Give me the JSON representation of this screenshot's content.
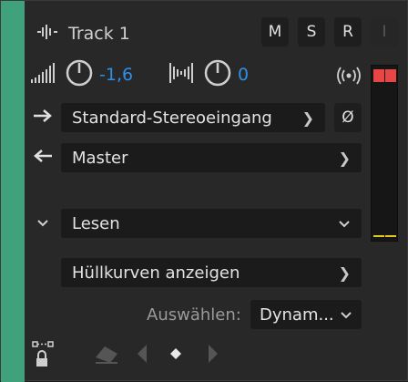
{
  "track": {
    "name": "Track 1",
    "volume": "-1,6",
    "pan": "0",
    "buttons": {
      "mute": "M",
      "solo": "S",
      "record": "R",
      "input": "I"
    }
  },
  "input": {
    "value": "Standard-Stereoeingang",
    "phase_symbol": "Ø"
  },
  "output": {
    "value": "Master"
  },
  "automation": {
    "mode": "Lesen"
  },
  "envelopes": {
    "label": "Hüllkurven anzeigen"
  },
  "select": {
    "label": "Auswählen:",
    "value": "Dynam..."
  },
  "colors": {
    "track": "#3fa27d",
    "accent_value": "#2f8fe8",
    "clip": "#e84545",
    "level": "#e3c91f"
  }
}
